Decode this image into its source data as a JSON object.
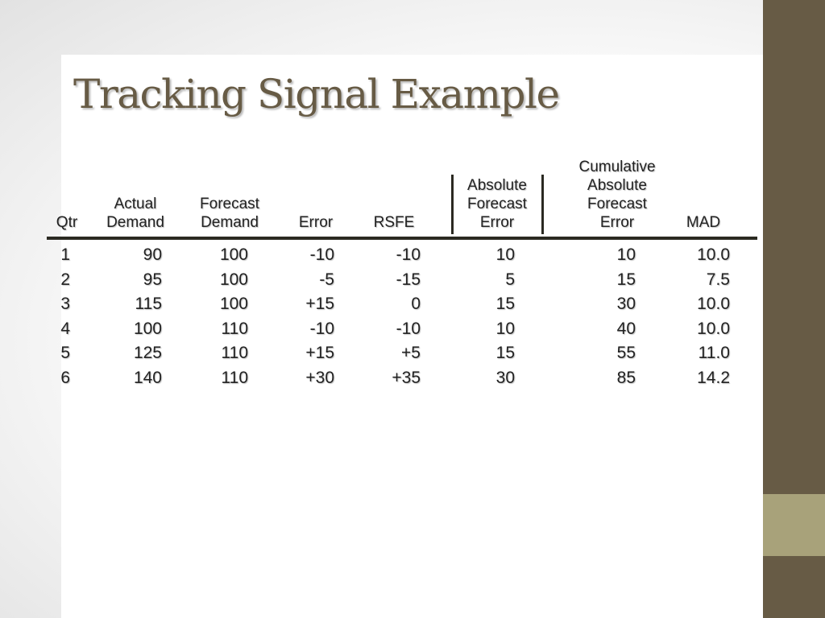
{
  "slide": {
    "title": "Tracking Signal Example",
    "colors": {
      "title": "#675b45",
      "side_band": "#675b45",
      "side_accent": "#a8a27a",
      "text": "#222222"
    }
  },
  "table": {
    "headers": [
      {
        "key": "qtr",
        "lines": [
          "Qtr"
        ]
      },
      {
        "key": "actual",
        "lines": [
          "Actual",
          "Demand"
        ]
      },
      {
        "key": "forecast",
        "lines": [
          "Forecast",
          "Demand"
        ]
      },
      {
        "key": "error",
        "lines": [
          "Error"
        ]
      },
      {
        "key": "rsfe",
        "lines": [
          "RSFE"
        ]
      },
      {
        "key": "abs_err",
        "lines": [
          "Absolute",
          "Forecast",
          "Error"
        ]
      },
      {
        "key": "cum_abs_err",
        "lines": [
          "Cumulative",
          "Absolute",
          "Forecast",
          "Error"
        ]
      },
      {
        "key": "mad",
        "lines": [
          "MAD"
        ]
      }
    ],
    "rows": [
      [
        "1",
        "90",
        "100",
        "-10",
        "-10",
        "10",
        "10",
        "10.0"
      ],
      [
        "2",
        "95",
        "100",
        "-5",
        "-15",
        "5",
        "15",
        "7.5"
      ],
      [
        "3",
        "115",
        "100",
        "+15",
        "0",
        "15",
        "30",
        "10.0"
      ],
      [
        "4",
        "100",
        "110",
        "-10",
        "-10",
        "10",
        "40",
        "10.0"
      ],
      [
        "5",
        "125",
        "110",
        "+15",
        "+5",
        "15",
        "55",
        "11.0"
      ],
      [
        "6",
        "140",
        "110",
        "+30",
        "+35",
        "30",
        "85",
        "14.2"
      ]
    ]
  }
}
